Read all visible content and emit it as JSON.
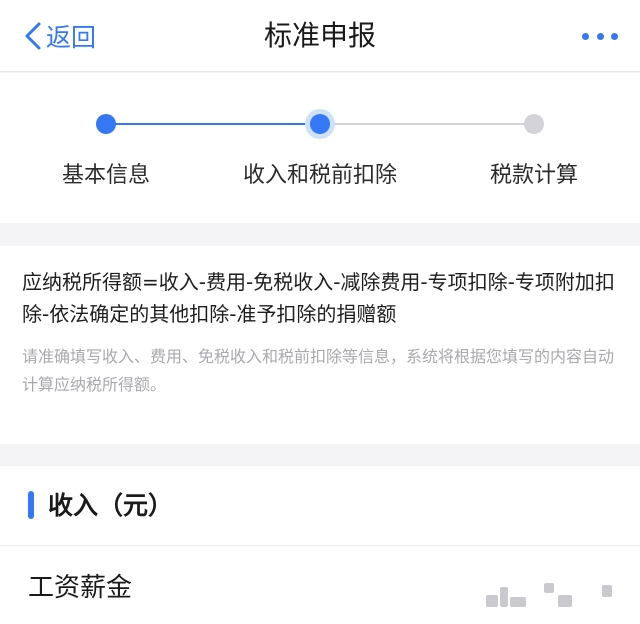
{
  "nav": {
    "back_label": "返回",
    "title": "标准申报",
    "more_icon": "more-horizontal-icon",
    "accent_color": "#3478f6"
  },
  "steps": {
    "items": [
      {
        "label": "基本信息",
        "state": "done"
      },
      {
        "label": "收入和税前扣除",
        "state": "current"
      },
      {
        "label": "税款计算",
        "state": "pending"
      }
    ]
  },
  "formula": {
    "text": "应纳税所得额=收入-费用-免税收入-减除费用-专项扣除-专项附加扣除-依法确定的其他扣除-准予扣除的捐赠额",
    "hint": "请准确填写收入、费用、免税收入和税前扣除等信息，系统将根据您填写的内容自动计算应纳税所得额。"
  },
  "income_section": {
    "title": "收入（元）",
    "rows": [
      {
        "label": "工资薪金"
      }
    ]
  }
}
